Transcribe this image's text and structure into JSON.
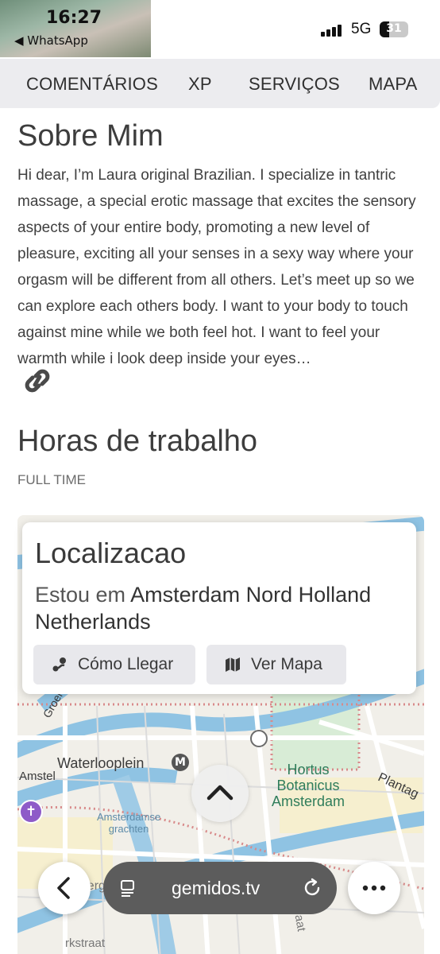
{
  "status_bar": {
    "time": "16:27",
    "back_app": "◀ WhatsApp",
    "network": "5G",
    "battery": "31"
  },
  "tabs": [
    {
      "label": "COMENTÁRIOS"
    },
    {
      "label": "XP"
    },
    {
      "label": "SERVIÇOS"
    },
    {
      "label": "MAPA"
    }
  ],
  "about": {
    "heading": "Sobre Mim",
    "text": "Hi dear, I’m Laura original Brazilian. I specialize in tantric massage, a special erotic massage that excites the sensory aspects of your entire body, promoting a new level of pleasure, exciting all your senses in a sexy way where your orgasm will be different from all others. Let’s meet up so we can explore each others body. I want to your body to touch against mine while we both feel hot. I want to feel your warmth while i look deep inside your eyes…"
  },
  "hours": {
    "heading": "Horas de trabalho",
    "value": "FULL TIME"
  },
  "location": {
    "title": "Localizacao",
    "prefix": "Estou em",
    "place": "Amsterdam Nord Holland Netherlands",
    "directions_label": "Cómo Llegar",
    "map_label": "Ver Mapa"
  },
  "map": {
    "labels": {
      "groenburg": "Groenbu",
      "waterlooplein": "Waterlooplein",
      "metro": "M",
      "amstel": "Amstel",
      "hortus": "Hortus\nBotanicus\nAmsterdam",
      "plantage": "Plantag",
      "grachten": "Amsterdamse\ngrachten",
      "bottom1": "agerg",
      "bottom2": "rkstraat",
      "bottom3": "traat"
    }
  },
  "browser": {
    "url": "gemidos.tv"
  },
  "icons": {
    "link": "link-icon",
    "directions": "route-icon",
    "map": "map-icon",
    "up": "chevron-up-icon",
    "back": "chevron-left-icon",
    "reader": "reader-icon",
    "reload": "reload-icon",
    "more": "more-icon"
  }
}
